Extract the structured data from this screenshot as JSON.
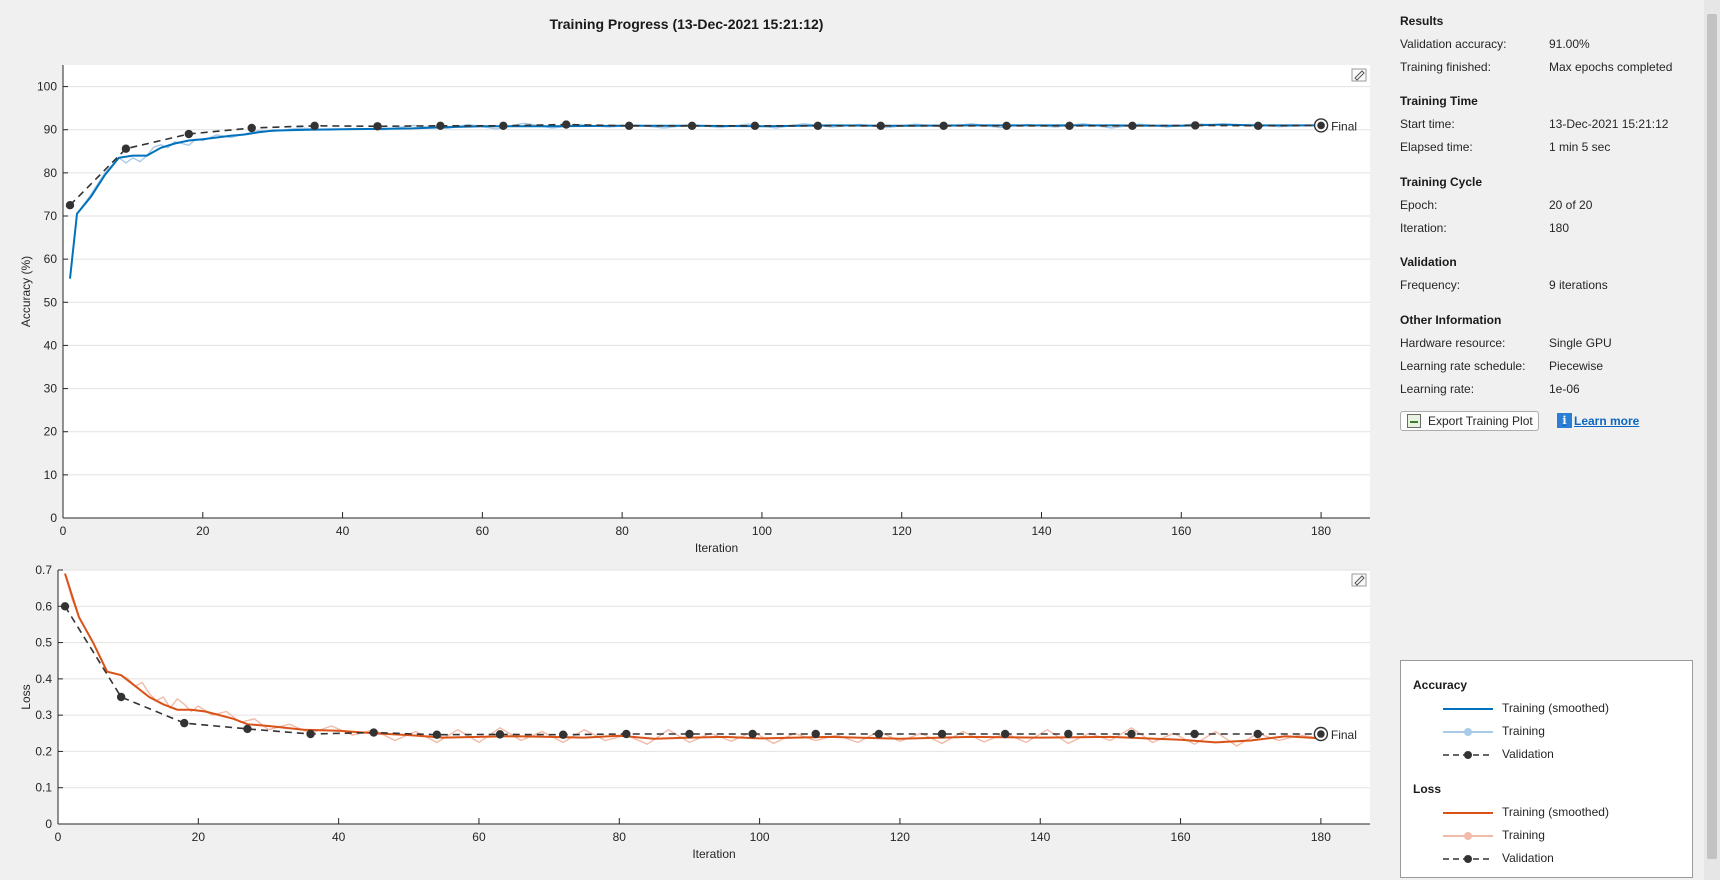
{
  "window": {
    "title": "Training Progress (13-Dec-2021 15:21:12)"
  },
  "results": {
    "header": "Results",
    "validation_accuracy_label": "Validation accuracy:",
    "validation_accuracy_value": "91.00%",
    "training_finished_label": "Training finished:",
    "training_finished_value": "Max epochs completed"
  },
  "training_time": {
    "header": "Training Time",
    "start_label": "Start time:",
    "start_value": "13-Dec-2021 15:21:12",
    "elapsed_label": "Elapsed time:",
    "elapsed_value": "1 min 5 sec"
  },
  "training_cycle": {
    "header": "Training Cycle",
    "epoch_label": "Epoch:",
    "epoch_value": "20 of 20",
    "iteration_label": "Iteration:",
    "iteration_value": "180"
  },
  "validation": {
    "header": "Validation",
    "frequency_label": "Frequency:",
    "frequency_value": "9 iterations"
  },
  "other": {
    "header": "Other Information",
    "hardware_label": "Hardware resource:",
    "hardware_value": "Single GPU",
    "schedule_label": "Learning rate schedule:",
    "schedule_value": "Piecewise",
    "lr_label": "Learning rate:",
    "lr_value": "1e-06"
  },
  "buttons": {
    "export_label": "Export Training Plot",
    "learn_more_label": "Learn more"
  },
  "legend": {
    "accuracy_header": "Accuracy",
    "loss_header": "Loss",
    "smoothed": "Training (smoothed)",
    "training": "Training",
    "validation": "Validation"
  },
  "colors": {
    "accuracy_smoothed": "#0072bd",
    "accuracy_raw": "#a9cbe8",
    "loss_smoothed": "#d95319",
    "loss_raw": "#f0bba8",
    "validation": "#333333"
  },
  "icons": [
    "export-plot-icon",
    "info-icon",
    "axes-toolbar-icon"
  ],
  "chart_data": [
    {
      "type": "line",
      "title": "",
      "xlabel": "Iteration",
      "ylabel": "Accuracy (%)",
      "xlim": [
        0,
        187
      ],
      "ylim": [
        0,
        105
      ],
      "xticks": [
        0,
        20,
        40,
        60,
        80,
        100,
        120,
        140,
        160,
        180
      ],
      "yticks": [
        0,
        10,
        20,
        30,
        40,
        50,
        60,
        70,
        80,
        90,
        100
      ],
      "grid": true,
      "final_label": "Final",
      "series": [
        {
          "name": "Training (smoothed)",
          "x": [
            1,
            2,
            4,
            6,
            8,
            10,
            12,
            14,
            16,
            18,
            20,
            22,
            24,
            26,
            28,
            30,
            35,
            40,
            45,
            50,
            55,
            60,
            70,
            80,
            90,
            100,
            110,
            120,
            130,
            140,
            150,
            160,
            166,
            170,
            180
          ],
          "y": [
            55.5,
            70.5,
            74.5,
            79.5,
            83.5,
            84,
            84,
            85.8,
            86.8,
            87.5,
            87.8,
            88.2,
            88.6,
            88.9,
            89.4,
            89.8,
            90,
            90.1,
            90.2,
            90.3,
            90.6,
            90.8,
            90.8,
            90.9,
            90.9,
            90.8,
            91,
            90.9,
            91,
            91,
            91,
            90.9,
            91.2,
            91,
            91
          ]
        },
        {
          "name": "Training",
          "x": [
            1,
            2,
            4,
            6,
            8,
            9,
            10,
            11,
            12,
            13,
            14,
            15,
            16,
            17,
            18,
            19,
            20,
            22,
            24,
            26,
            28,
            30,
            34,
            38,
            42,
            46,
            50,
            55,
            58,
            62,
            66,
            70,
            74,
            78,
            82,
            86,
            90,
            94,
            98,
            102,
            106,
            110,
            114,
            118,
            122,
            126,
            130,
            134,
            138,
            142,
            146,
            150,
            154,
            158,
            162,
            166,
            170,
            174,
            178,
            180
          ],
          "y": [
            55.5,
            70.5,
            75,
            80,
            83.5,
            82.3,
            83.5,
            82.6,
            84,
            86,
            86.5,
            85.8,
            87.2,
            86.8,
            86.4,
            87.8,
            87.5,
            88.8,
            88.2,
            89,
            89.8,
            89.6,
            90.4,
            89.9,
            90.3,
            90,
            91,
            90.3,
            91.2,
            90.2,
            91.5,
            90.4,
            91.2,
            90.6,
            91.1,
            90.4,
            91.2,
            90.5,
            91.3,
            90.4,
            91.4,
            90.6,
            91.2,
            90.5,
            91.3,
            90.6,
            91.4,
            90.5,
            91.2,
            90.6,
            91.4,
            90.4,
            91.3,
            90.6,
            91.4,
            91,
            91.2,
            90.7,
            91,
            91
          ]
        },
        {
          "name": "Validation",
          "x": [
            1,
            9,
            18,
            27,
            36,
            45,
            54,
            63,
            72,
            81,
            90,
            99,
            108,
            117,
            126,
            135,
            144,
            153,
            162,
            171,
            180
          ],
          "y": [
            72.5,
            85.6,
            89,
            90.4,
            90.9,
            90.8,
            90.9,
            90.9,
            91.2,
            90.9,
            90.9,
            90.9,
            90.9,
            90.9,
            90.9,
            90.9,
            90.9,
            90.9,
            91,
            90.9,
            91
          ]
        }
      ]
    },
    {
      "type": "line",
      "title": "",
      "xlabel": "Iteration",
      "ylabel": "Loss",
      "xlim": [
        0,
        187
      ],
      "ylim": [
        0,
        0.7
      ],
      "xticks": [
        0,
        20,
        40,
        60,
        80,
        100,
        120,
        140,
        160,
        180
      ],
      "yticks": [
        0,
        0.1,
        0.2,
        0.3,
        0.4,
        0.5,
        0.6,
        0.7
      ],
      "grid": true,
      "final_label": "Final",
      "series": [
        {
          "name": "Training (smoothed)",
          "x": [
            1,
            2,
            3,
            5,
            7,
            9,
            11,
            13,
            15,
            17,
            19,
            21,
            23,
            25,
            27,
            30,
            35,
            40,
            45,
            50,
            55,
            60,
            65,
            70,
            75,
            80,
            85,
            90,
            95,
            100,
            110,
            120,
            130,
            140,
            150,
            160,
            165,
            170,
            175,
            180
          ],
          "y": [
            0.69,
            0.63,
            0.57,
            0.5,
            0.42,
            0.41,
            0.38,
            0.35,
            0.33,
            0.315,
            0.315,
            0.31,
            0.3,
            0.29,
            0.275,
            0.27,
            0.26,
            0.257,
            0.25,
            0.245,
            0.238,
            0.24,
            0.242,
            0.24,
            0.238,
            0.243,
            0.235,
            0.238,
            0.24,
            0.236,
            0.24,
            0.235,
            0.24,
            0.238,
            0.24,
            0.232,
            0.225,
            0.23,
            0.242,
            0.236
          ]
        },
        {
          "name": "Training",
          "x": [
            1,
            2,
            3,
            5,
            7,
            9,
            10,
            11,
            12,
            13,
            14,
            15,
            16,
            17,
            18,
            19,
            20,
            22,
            24,
            26,
            28,
            30,
            33,
            36,
            39,
            42,
            45,
            48,
            51,
            54,
            57,
            60,
            63,
            66,
            69,
            72,
            75,
            78,
            81,
            84,
            87,
            90,
            93,
            96,
            99,
            102,
            105,
            108,
            111,
            114,
            117,
            120,
            123,
            126,
            129,
            132,
            135,
            138,
            141,
            144,
            147,
            150,
            153,
            156,
            159,
            162,
            165,
            168,
            171,
            174,
            177,
            180
          ],
          "y": [
            0.69,
            0.62,
            0.57,
            0.5,
            0.42,
            0.41,
            0.4,
            0.38,
            0.39,
            0.36,
            0.34,
            0.35,
            0.32,
            0.345,
            0.33,
            0.31,
            0.325,
            0.3,
            0.31,
            0.28,
            0.29,
            0.26,
            0.275,
            0.25,
            0.27,
            0.245,
            0.26,
            0.23,
            0.255,
            0.225,
            0.26,
            0.225,
            0.265,
            0.23,
            0.255,
            0.225,
            0.26,
            0.23,
            0.245,
            0.22,
            0.26,
            0.225,
            0.25,
            0.228,
            0.255,
            0.222,
            0.25,
            0.23,
            0.245,
            0.225,
            0.255,
            0.228,
            0.25,
            0.222,
            0.255,
            0.226,
            0.25,
            0.225,
            0.26,
            0.222,
            0.25,
            0.23,
            0.265,
            0.225,
            0.25,
            0.22,
            0.255,
            0.215,
            0.25,
            0.23,
            0.245,
            0.236
          ]
        },
        {
          "name": "Validation",
          "x": [
            1,
            9,
            18,
            27,
            36,
            45,
            54,
            63,
            72,
            81,
            90,
            99,
            108,
            117,
            126,
            135,
            144,
            153,
            162,
            171,
            180
          ],
          "y": [
            0.6,
            0.35,
            0.278,
            0.262,
            0.248,
            0.252,
            0.246,
            0.247,
            0.246,
            0.248,
            0.248,
            0.248,
            0.248,
            0.248,
            0.248,
            0.248,
            0.248,
            0.248,
            0.248,
            0.248,
            0.248
          ]
        }
      ]
    }
  ]
}
